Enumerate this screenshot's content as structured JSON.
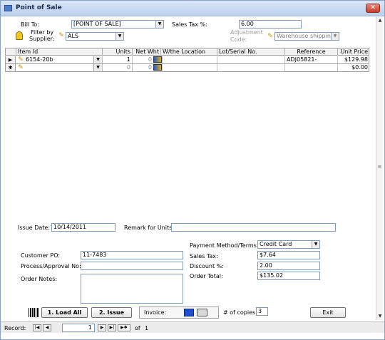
{
  "window": {
    "title": "Point of Sale",
    "close_glyph": "✕"
  },
  "header": {
    "bill_to_label": "Bill To:",
    "bill_to_value": "[POINT OF SALE]",
    "sales_tax_pct_label": "Sales Tax %:",
    "sales_tax_pct_value": "6.00",
    "filter_label_1": "Filter by",
    "filter_label_2": "Supplier:",
    "filter_value": "ALS",
    "adjustment_label_1": "Adjustment",
    "adjustment_label_2": "Code:",
    "adjustment_value": "Warehouse shipping"
  },
  "grid": {
    "columns": [
      "Item Id",
      "Units",
      "Net Wht",
      "W/the Location",
      "Lot/Serial No.",
      "Reference",
      "Unit Price"
    ],
    "rows": [
      {
        "selector": "▶",
        "item_id": "6154-20b",
        "units": "1",
        "net_wht": "0",
        "location": "",
        "lot": "",
        "reference": "ADJ05821-",
        "unit_price": "$129.98"
      },
      {
        "selector": "✱",
        "item_id": "",
        "units": "0",
        "net_wht": "0",
        "location": "",
        "lot": "",
        "reference": "",
        "unit_price": "$0.00"
      }
    ]
  },
  "issue": {
    "issue_date_label": "Issue Date:",
    "issue_date_value": "10/14/2011",
    "remark_label": "Remark for Units:",
    "remark_value": ""
  },
  "left_fields": {
    "customer_po_label": "Customer PO:",
    "customer_po_value": "11-7483",
    "approval_label": "Process/Approval No:",
    "approval_value": "",
    "notes_label": "Order Notes:",
    "notes_value": ""
  },
  "payment": {
    "method_label": "Payment Method/Terms:",
    "method_value": "Credit Card",
    "sales_tax_label": "Sales Tax:",
    "sales_tax_value": "$7.64",
    "discount_label": "Discount %:",
    "discount_value": "2.00",
    "order_total_label": "Order Total:",
    "order_total_value": "$135.02"
  },
  "actions": {
    "load_all_label": "1. Load All",
    "issue_label": "2. Issue",
    "invoice_label": "Invoice:",
    "copies_label": "# of copies:",
    "copies_value": "3",
    "exit_label": "Exit"
  },
  "record_nav": {
    "label": "Record:",
    "current": "1",
    "of_label": "of",
    "total": "1",
    "first": "|◀",
    "prev": "◀",
    "next": "▶",
    "last": "▶|",
    "new": "▶✱"
  },
  "colors": {
    "title_text": "#1a2c4d",
    "close": "#c53b2a",
    "border": "#7f9db9"
  }
}
